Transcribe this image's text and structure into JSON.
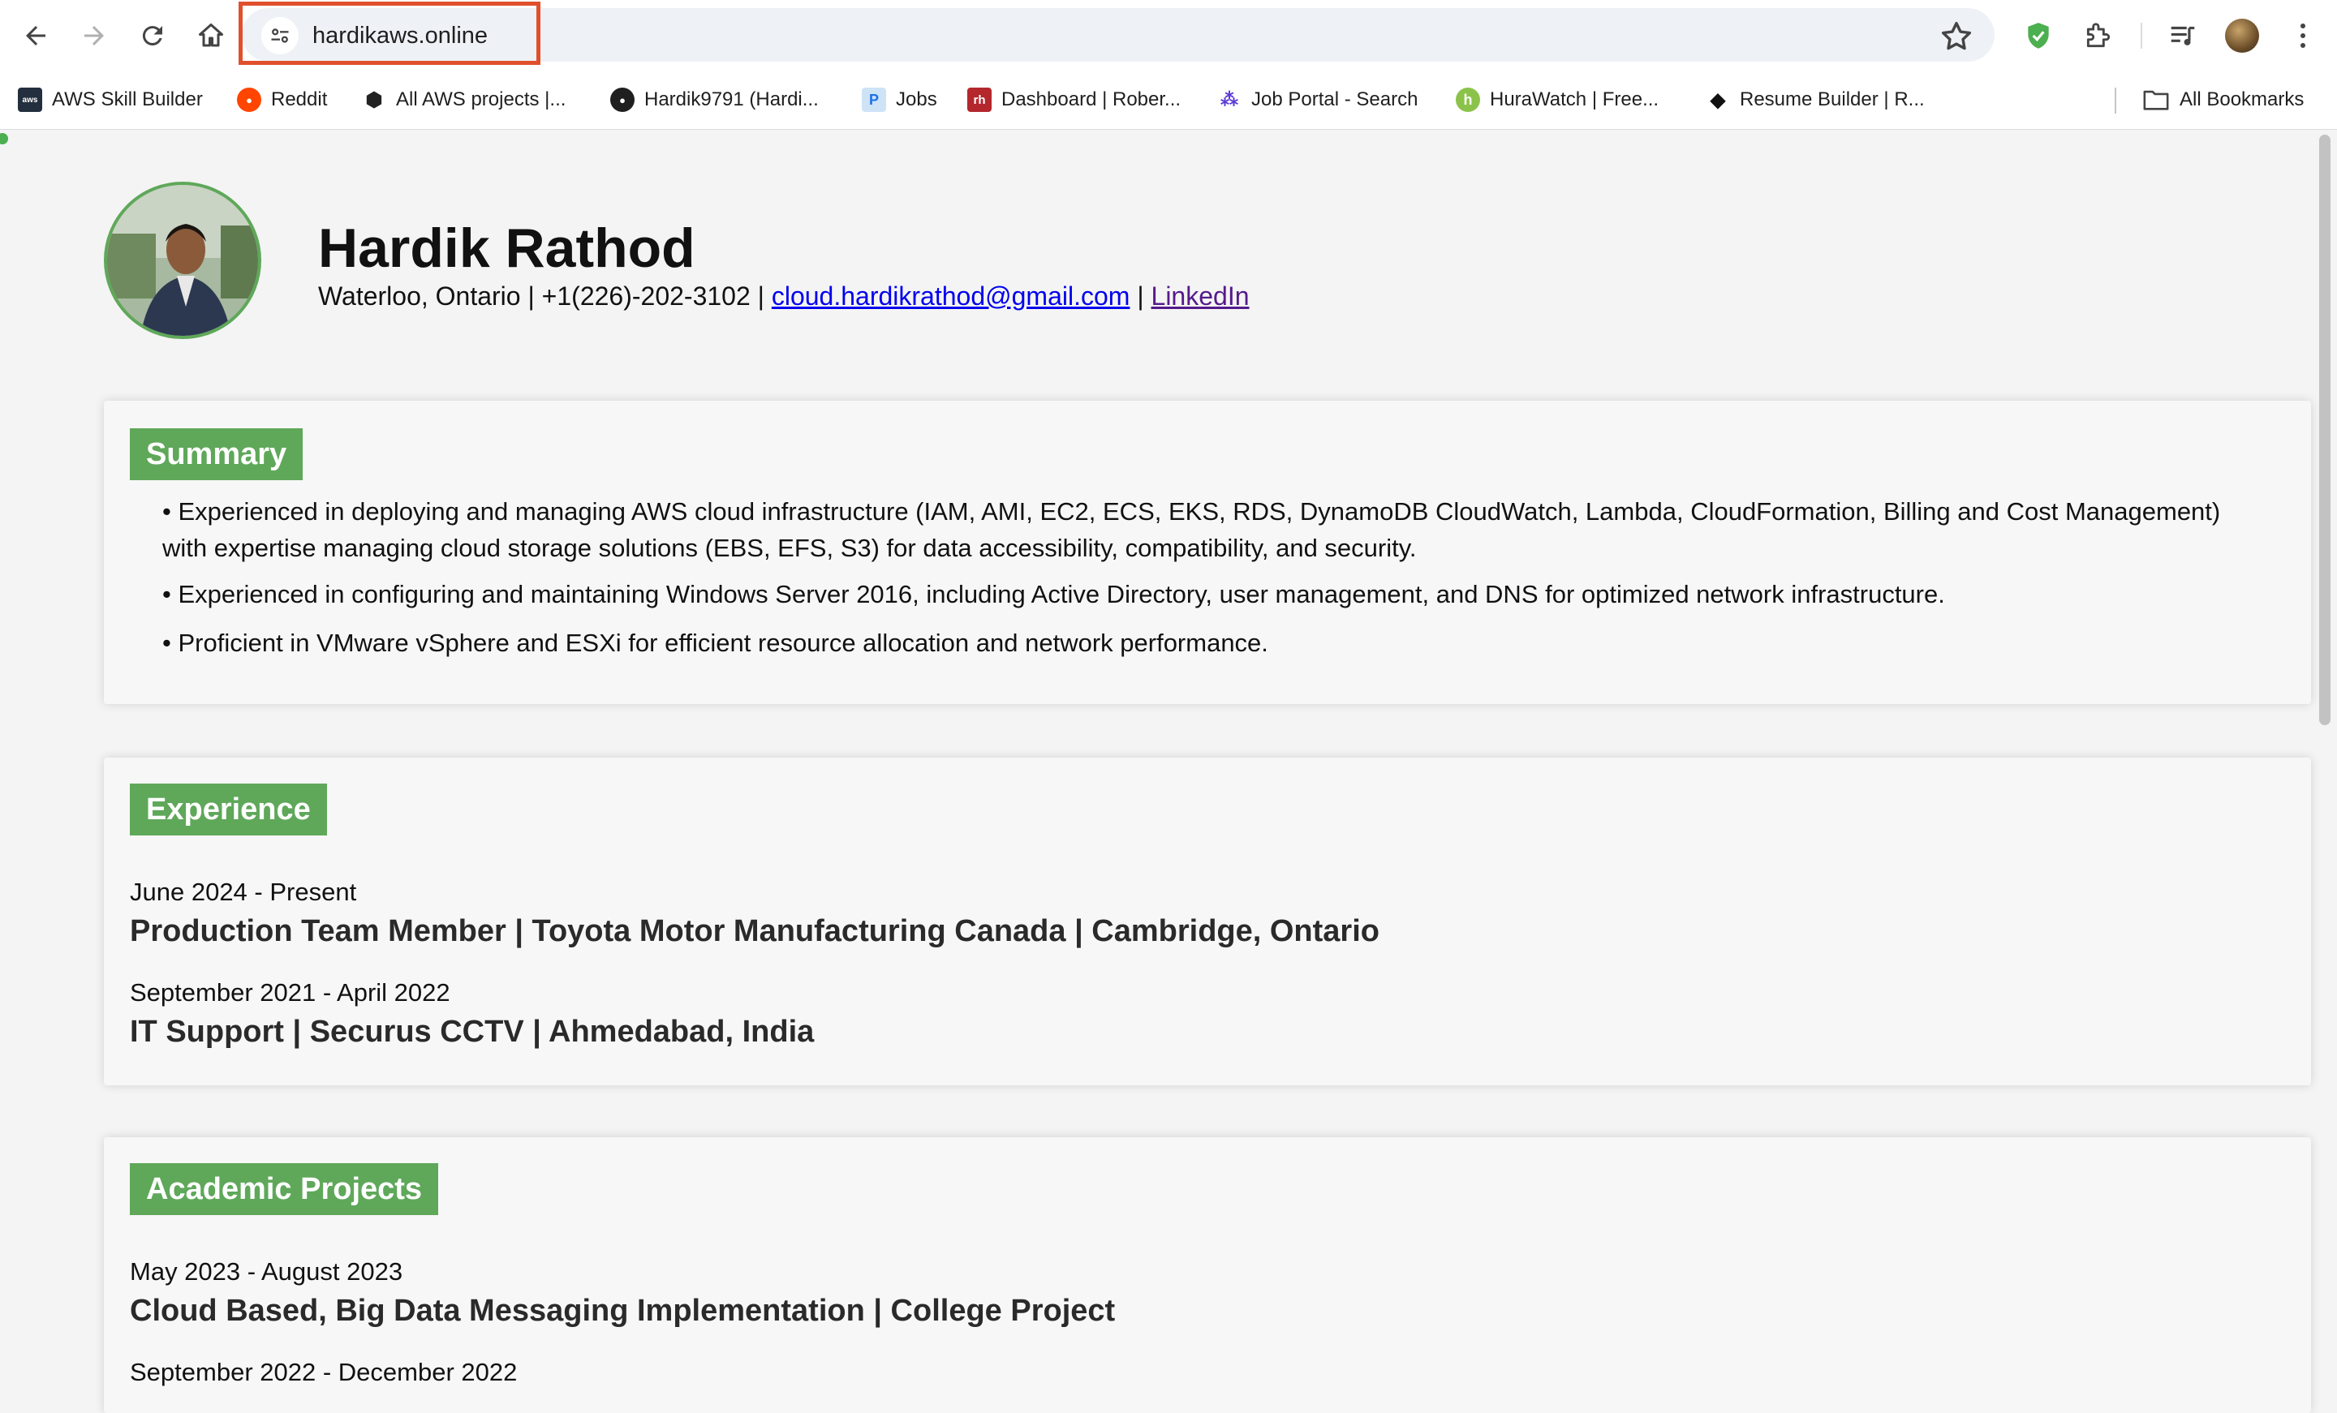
{
  "browser": {
    "url": "hardikaws.online",
    "bookmarks": [
      {
        "label": "AWS Skill Builder",
        "icon": "aws-icon"
      },
      {
        "label": "Reddit",
        "icon": "reddit-icon"
      },
      {
        "label": "All AWS projects |...",
        "icon": "cube-icon"
      },
      {
        "label": "Hardik9791 (Hardi...",
        "icon": "github-icon"
      },
      {
        "label": "Jobs",
        "icon": "p-icon"
      },
      {
        "label": "Dashboard | Rober...",
        "icon": "rh-icon"
      },
      {
        "label": "Job Portal - Search",
        "icon": "nodes-icon"
      },
      {
        "label": "HuraWatch | Free...",
        "icon": "hurawatch-icon"
      },
      {
        "label": "Resume Builder | R...",
        "icon": "resume-icon"
      }
    ],
    "all_bookmarks_label": "All Bookmarks"
  },
  "profile": {
    "name": "Hardik Rathod",
    "contact_location_phone": "Waterloo, Ontario | +1(226)-202-3102 | ",
    "email": "cloud.hardikrathod@gmail.com",
    "separator": " | ",
    "linkedin": "LinkedIn"
  },
  "summary": {
    "title": "Summary",
    "bullets": [
      "• Experienced in deploying and managing AWS cloud infrastructure (IAM, AMI, EC2, ECS, EKS, RDS, DynamoDB CloudWatch, Lambda, CloudFormation, Billing and Cost Management) with expertise managing cloud storage solutions (EBS, EFS, S3) for data accessibility, compatibility, and security.",
      "• Experienced in configuring and maintaining Windows Server 2016, including Active Directory, user management, and DNS for optimized network infrastructure.",
      "• Proficient in VMware vSphere and ESXi for efficient resource allocation and network performance."
    ]
  },
  "experience": {
    "title": "Experience",
    "items": [
      {
        "date": "June 2024 - Present",
        "role": "Production Team Member | Toyota Motor Manufacturing Canada | Cambridge, Ontario"
      },
      {
        "date": "September 2021 - April 2022",
        "role": "IT Support | Securus CCTV | Ahmedabad, India"
      }
    ]
  },
  "projects": {
    "title": "Academic Projects",
    "items": [
      {
        "date": "May 2023 - August 2023",
        "role": "Cloud Based, Big Data Messaging Implementation | College Project"
      },
      {
        "date": "September 2022 - December 2022",
        "role": ""
      }
    ]
  },
  "colors": {
    "accent": "#5fa85a",
    "highlight": "#e0502c",
    "link": "#0000ee",
    "visited_link": "#551a8b"
  }
}
